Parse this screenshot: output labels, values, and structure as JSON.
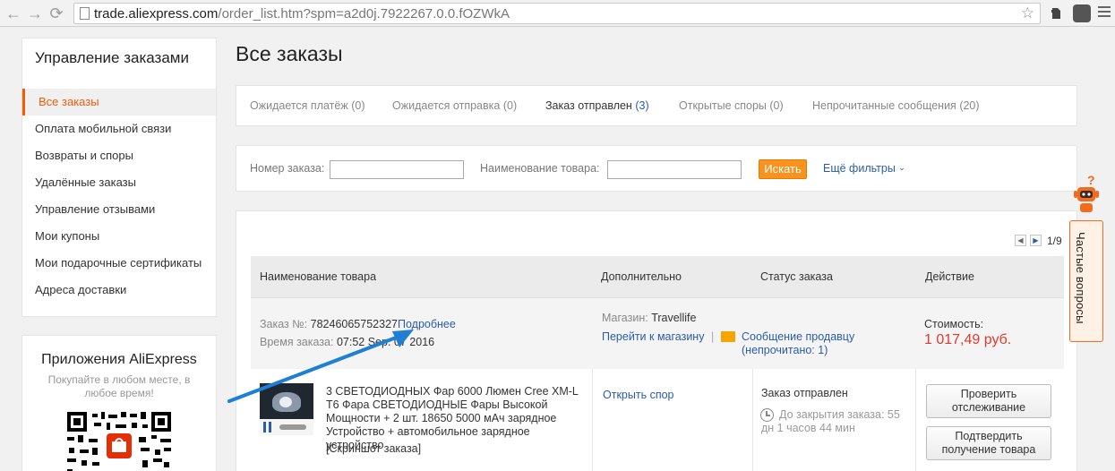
{
  "browser": {
    "url_host": "trade.aliexpress.com",
    "url_path": "/order_list.htm?spm=a2d0j.7922267.0.0.fOZWkA"
  },
  "sidebar": {
    "title": "Управление заказами",
    "items": [
      {
        "label": "Все заказы",
        "active": true
      },
      {
        "label": "Оплата мобильной связи"
      },
      {
        "label": "Возвраты и споры"
      },
      {
        "label": "Удалённые заказы"
      },
      {
        "label": "Управление отзывами"
      },
      {
        "label": "Мои купоны"
      },
      {
        "label": "Мои подарочные сертификаты"
      },
      {
        "label": "Адреса доставки"
      }
    ],
    "apps_title": "Приложения AliExpress",
    "apps_sub": "Покупайте в любом месте, в любое время!"
  },
  "main": {
    "title": "Все заказы",
    "tabs": [
      {
        "label": "Ожидается платёж",
        "count": "(0)"
      },
      {
        "label": "Ожидается отправка",
        "count": "(0)"
      },
      {
        "label": "Заказ отправлен",
        "count": "(3)",
        "active": true
      },
      {
        "label": "Открытые споры",
        "count": "(0)"
      },
      {
        "label": "Непрочитанные сообщения",
        "count": "(20)"
      }
    ],
    "filters": {
      "order_label": "Номер заказа:",
      "product_label": "Наименование товара:",
      "search_label": "Искать",
      "more_label": "Ещё фильтры"
    },
    "pager": "1/9",
    "columns": [
      "Наименование товара",
      "Дополнительно",
      "Статус заказа",
      "Действие"
    ],
    "order": {
      "number_label": "Заказ №:",
      "number": "78246065752327",
      "details_link": "Подробнее",
      "time_label": "Время заказа:",
      "time": "07:52 Sep. 07 2016",
      "store_label": "Магазин:",
      "store": "Travellife",
      "store_link": "Перейти к магазину",
      "message_link": "Сообщение продавцу",
      "unread_label": "(непрочитано:",
      "unread_count": "1",
      "unread_close": ")",
      "cost_label": "Стоимость:",
      "cost": "1 017,49 руб.",
      "product_title": "3 СВЕТОДИОДНЫХ Фар 6000 Люмен Cree XM-L T6 Фара СВЕТОДИОДНЫЕ Фары Высокой Мощности + 2 шт. 18650 5000 мАч зарядное Устройство + автомобильное зарядное устройство",
      "snapshot": "[Скриншот заказа]",
      "dispute": "Открыть спор",
      "status": "Заказ отправлен",
      "countdown": "До закрытия заказа: 55 дн 1 часов 44 мин",
      "btn_track": "Проверить отслеживание",
      "btn_confirm": "Подтвердить получение товара"
    }
  },
  "faq": {
    "label": "Частые вопросы"
  },
  "colors": {
    "accent": "#f25c05",
    "link": "#2a5ca8",
    "price": "#e4392a",
    "button": "#f7931e"
  }
}
